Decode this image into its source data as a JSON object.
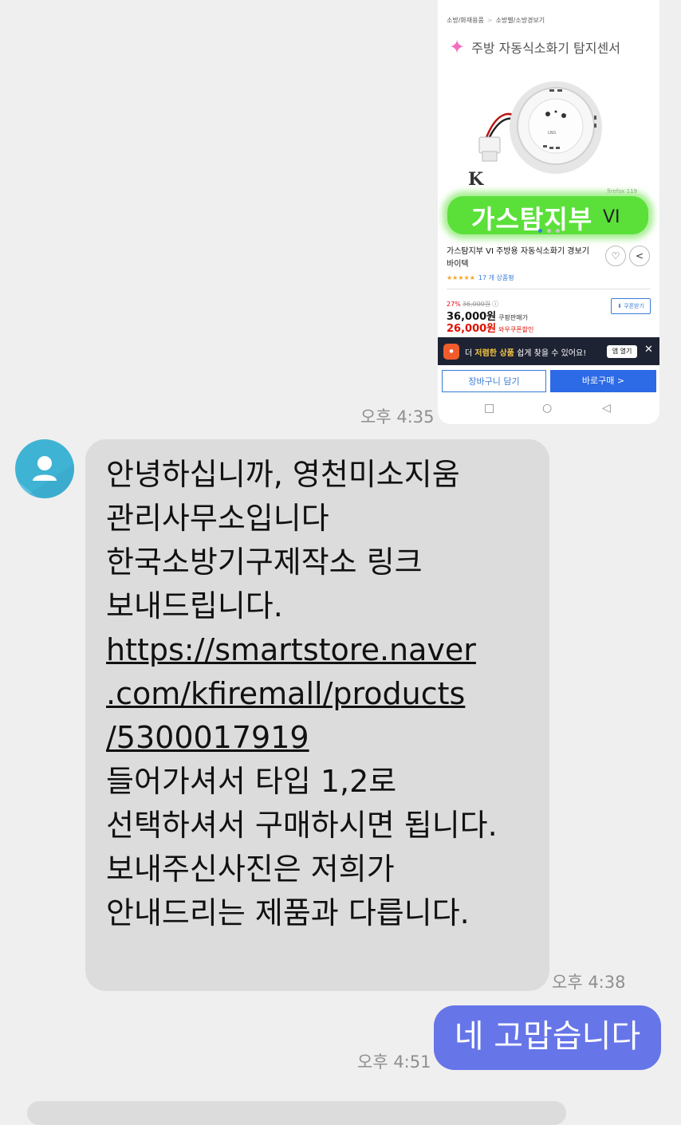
{
  "screenshot_card": {
    "breadcrumb": [
      "소방/화재용품",
      "소방벨/소방경보기"
    ],
    "category_title": "주방 자동식소화기 탐지센서",
    "kc_mark": "K",
    "brand_watermark": "firefox 119",
    "banner_text": "가스탐지부",
    "banner_suffix": "VI",
    "product_name": "가스탐지부 VI 주방용 자동식소화기 경보기 바이텍",
    "rating_stars": "★★★★★",
    "review_count": "17 개 상품평",
    "discount_rate": "27%",
    "original_price": "36,000원",
    "price": "36,000원",
    "price_label": "쿠팡판매가",
    "coupon_price": "26,000원",
    "coupon_price_label": "와우쿠폰할인",
    "coupon_button": "쿠폰받기",
    "app_banner_prefix": "더",
    "app_banner_highlight": "저렴한 상품",
    "app_banner_suffix": "쉽게 찾을 수 있어요!",
    "app_open_button": "앱 열기",
    "cart_button": "장바구니 담기",
    "buy_button": "바로구매 >",
    "nav_recent": "□",
    "nav_home": "○",
    "nav_back": "◁"
  },
  "messages": {
    "sent_image_time": "오후 4:35",
    "incoming_lines_before_link": "안녕하십니까, 영천미소지움\n관리사무소입니다\n한국소방기구제작소 링크\n보내드립니다.",
    "incoming_link": "https://smartstore.naver\n.com/kfiremall/products\n/5300017919",
    "incoming_lines_after_link": "들어가셔서 타입 1,2로\n선택하셔서 구매하시면 됩니다.\n보내주신사진은 저희가\n안내드리는 제품과 다릅니다.",
    "incoming_time": "오후 4:38",
    "outgoing_text": "네 고맙습니다",
    "outgoing_time": "오후 4:51"
  },
  "colors": {
    "background": "#efefef",
    "incoming_bubble": "#dcdcdc",
    "outgoing_bubble": "#6675e8",
    "avatar": "#3fb3d4"
  }
}
